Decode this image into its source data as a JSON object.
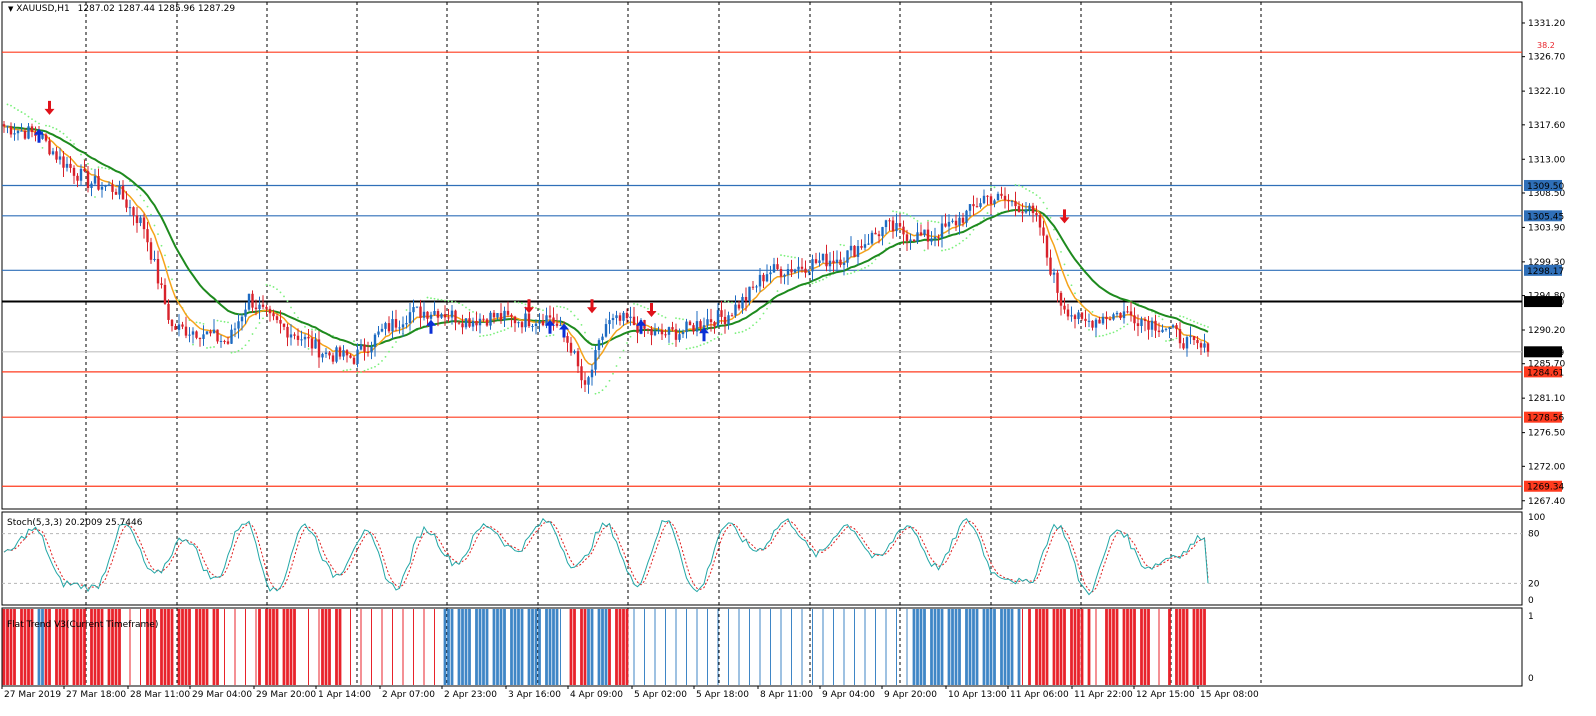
{
  "header": {
    "symbol_tf": "XAUUSD,H1",
    "ohlc": "1287.02 1287.44 1285.96 1287.29"
  },
  "fib_label": "38.2",
  "stoch_header": "Stoch(5,3,3) 20.2009 25.7446",
  "trend_header": "Flat Trend V3(Current Timeframe)",
  "colors": {
    "bull_candle": "#1e6bc2",
    "bear_candle": "#d8222b",
    "ma_fast": "#f5a31a",
    "ma_slow": "#1e8a1e",
    "sar": "#7cf07c",
    "support_red": "#ff3b1f",
    "resistance_blue": "#2f6fb8",
    "pivot_black": "#000000",
    "stoch_main": "#23a7a7",
    "stoch_signal": "#e01e1e",
    "trend_red": "#e8232b",
    "trend_blue": "#3f86c6"
  },
  "chart_data": [
    {
      "type": "candlestick",
      "title": "XAUUSD,H1",
      "ylim": [
        1266.3,
        1334.0
      ],
      "yticks": [
        "1331.20",
        "1326.70",
        "1322.10",
        "1317.60",
        "1313.00",
        "1308.50",
        "1303.90",
        "1299.30",
        "1294.80",
        "1290.20",
        "1285.70",
        "1281.10",
        "1276.50",
        "1272.00",
        "1267.40"
      ],
      "x_labels": [
        "27 Mar 2019",
        "27 Mar 18:00",
        "28 Mar 11:00",
        "29 Mar 04:00",
        "29 Mar 20:00",
        "1 Apr 14:00",
        "2 Apr 07:00",
        "2 Apr 23:00",
        "3 Apr 16:00",
        "4 Apr 09:00",
        "5 Apr 02:00",
        "5 Apr 18:00",
        "8 Apr 11:00",
        "9 Apr 04:00",
        "9 Apr 20:00",
        "10 Apr 13:00",
        "11 Apr 06:00",
        "11 Apr 22:00",
        "12 Apr 15:00",
        "15 Apr 08:00"
      ],
      "horizontal_levels": [
        {
          "value": 1327.3,
          "label": "",
          "kind": "fib"
        },
        {
          "value": 1309.5,
          "label": "1309.50",
          "kind": "resistance_blue"
        },
        {
          "value": 1305.45,
          "label": "1305.45",
          "kind": "resistance_blue"
        },
        {
          "value": 1298.17,
          "label": "1298.17",
          "kind": "resistance_blue"
        },
        {
          "value": 1294.0,
          "label": "1294.00",
          "kind": "pivot_black"
        },
        {
          "value": 1287.29,
          "label": "1287.29",
          "kind": "current"
        },
        {
          "value": 1284.61,
          "label": "1284.61",
          "kind": "support_red"
        },
        {
          "value": 1278.56,
          "label": "1278.56",
          "kind": "support_red"
        },
        {
          "value": 1269.34,
          "label": "1269.34",
          "kind": "support_red"
        }
      ],
      "close_anchors": [
        [
          0,
          1317.4
        ],
        [
          10,
          1316.2
        ],
        [
          16,
          1313.0
        ],
        [
          24,
          1310.0
        ],
        [
          32,
          1309.0
        ],
        [
          40,
          1304.0
        ],
        [
          44,
          1297.0
        ],
        [
          48,
          1290.5
        ],
        [
          56,
          1290.0
        ],
        [
          64,
          1288.5
        ],
        [
          70,
          1294.5
        ],
        [
          76,
          1291.5
        ],
        [
          84,
          1289.5
        ],
        [
          92,
          1287.0
        ],
        [
          100,
          1286.5
        ],
        [
          108,
          1290.0
        ],
        [
          116,
          1292.5
        ],
        [
          124,
          1292.8
        ],
        [
          132,
          1291.5
        ],
        [
          140,
          1292.0
        ],
        [
          148,
          1291.5
        ],
        [
          156,
          1292.0
        ],
        [
          162,
          1288.0
        ],
        [
          166,
          1282.0
        ],
        [
          172,
          1291.0
        ],
        [
          178,
          1291.5
        ],
        [
          186,
          1289.5
        ],
        [
          194,
          1290.0
        ],
        [
          200,
          1291.5
        ],
        [
          206,
          1292.0
        ],
        [
          212,
          1294.5
        ],
        [
          218,
          1298.0
        ],
        [
          226,
          1298.5
        ],
        [
          234,
          1299.5
        ],
        [
          240,
          1300.0
        ],
        [
          246,
          1302.0
        ],
        [
          252,
          1304.0
        ],
        [
          258,
          1303.0
        ],
        [
          264,
          1302.5
        ],
        [
          270,
          1304.0
        ],
        [
          276,
          1306.0
        ],
        [
          280,
          1308.0
        ],
        [
          286,
          1307.5
        ],
        [
          292,
          1306.5
        ],
        [
          296,
          1304.0
        ],
        [
          298,
          1300.0
        ],
        [
          302,
          1294.0
        ],
        [
          308,
          1291.0
        ],
        [
          314,
          1292.0
        ],
        [
          320,
          1292.5
        ],
        [
          326,
          1291.5
        ],
        [
          332,
          1290.5
        ],
        [
          338,
          1288.5
        ],
        [
          344,
          1287.3
        ]
      ],
      "up_arrows": [
        {
          "index": 10,
          "price": 1316.0
        },
        {
          "index": 122,
          "price": 1290.5
        },
        {
          "index": 156,
          "price": 1290.5
        },
        {
          "index": 160,
          "price": 1290.0
        },
        {
          "index": 182,
          "price": 1290.5
        },
        {
          "index": 200,
          "price": 1289.5
        }
      ],
      "down_arrows": [
        {
          "index": 13,
          "price": 1320.0
        },
        {
          "index": 150,
          "price": 1293.5
        },
        {
          "index": 168,
          "price": 1293.5
        },
        {
          "index": 185,
          "price": 1293.0
        },
        {
          "index": 303,
          "price": 1305.5
        }
      ],
      "series": [
        {
          "name": "",
          "kind": "ma_fast",
          "period": 8
        },
        {
          "name": "",
          "kind": "ma_slow",
          "period": 24
        },
        {
          "name": "",
          "kind": "parabolic_sar"
        }
      ]
    },
    {
      "type": "line",
      "title": "Stoch(5,3,3)",
      "ylim": [
        0,
        100
      ],
      "yticks": [
        "100",
        "80",
        "20",
        "0"
      ],
      "levels": [
        80,
        20
      ],
      "main_value": 20.2009,
      "signal_value": 25.7446,
      "cycle_pattern": [
        55,
        85,
        20,
        15,
        90,
        30,
        75,
        25,
        95,
        10,
        90,
        30,
        80,
        15,
        85,
        45,
        90,
        60,
        95,
        40,
        90,
        20,
        95,
        10,
        90,
        60,
        95,
        55,
        90,
        50,
        90,
        40,
        95,
        30,
        20,
        90,
        10,
        85,
        40,
        55,
        80
      ]
    },
    {
      "type": "bar",
      "title": "Flat Trend V3(Current Timeframe)",
      "ylim": [
        0,
        1
      ],
      "yticks": [
        "1",
        "0"
      ],
      "segments": [
        {
          "from": 0,
          "to": 8,
          "state": "red"
        },
        {
          "from": 9,
          "to": 11,
          "state": "blue"
        },
        {
          "from": 12,
          "to": 34,
          "state": "red"
        },
        {
          "from": 35,
          "to": 40,
          "state": "red_light"
        },
        {
          "from": 41,
          "to": 61,
          "state": "red"
        },
        {
          "from": 62,
          "to": 72,
          "state": "red_light"
        },
        {
          "from": 73,
          "to": 84,
          "state": "red"
        },
        {
          "from": 85,
          "to": 90,
          "state": "red_light"
        },
        {
          "from": 91,
          "to": 96,
          "state": "red"
        },
        {
          "from": 97,
          "to": 125,
          "state": "red_light"
        },
        {
          "from": 126,
          "to": 158,
          "state": "blue"
        },
        {
          "from": 159,
          "to": 161,
          "state": "blue_light"
        },
        {
          "from": 162,
          "to": 166,
          "state": "red"
        },
        {
          "from": 167,
          "to": 172,
          "state": "blue"
        },
        {
          "from": 173,
          "to": 178,
          "state": "red"
        },
        {
          "from": 179,
          "to": 210,
          "state": "blue_light"
        },
        {
          "from": 211,
          "to": 235,
          "state": "blue_light"
        },
        {
          "from": 236,
          "to": 258,
          "state": "blue_light"
        },
        {
          "from": 259,
          "to": 290,
          "state": "blue"
        },
        {
          "from": 291,
          "to": 292,
          "state": "red_light"
        },
        {
          "from": 293,
          "to": 310,
          "state": "red"
        },
        {
          "from": 311,
          "to": 314,
          "state": "red_light"
        },
        {
          "from": 315,
          "to": 327,
          "state": "red"
        },
        {
          "from": 328,
          "to": 332,
          "state": "red_light"
        },
        {
          "from": 333,
          "to": 344,
          "state": "red"
        }
      ]
    }
  ]
}
